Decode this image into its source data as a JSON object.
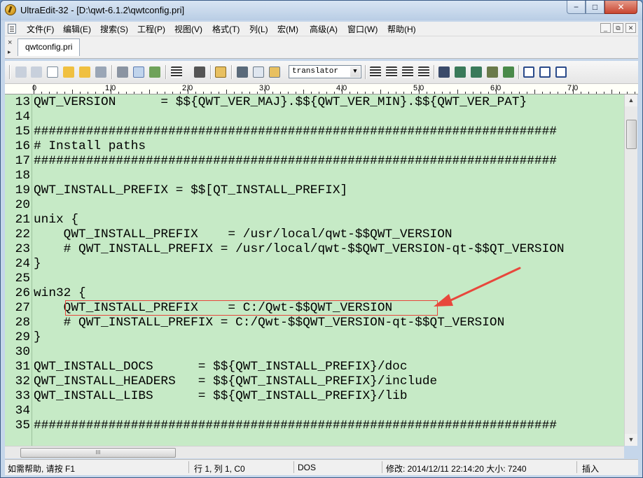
{
  "window": {
    "title": "UltraEdit-32 - [D:\\qwt-6.1.2\\qwtconfig.pri]",
    "controls": {
      "minimize": "−",
      "maximize": "□",
      "close": "✕"
    }
  },
  "menu": {
    "items": [
      "文件(F)",
      "编辑(E)",
      "搜索(S)",
      "工程(P)",
      "视图(V)",
      "格式(T)",
      "列(L)",
      "宏(M)",
      "高级(A)",
      "窗口(W)",
      "帮助(H)"
    ],
    "mdi_controls": [
      "_",
      "⧉",
      "✕"
    ]
  },
  "tabs": {
    "active_file": "qwtconfig.pri",
    "close_glyph": "×",
    "pin_glyph": "▸"
  },
  "toolbar": {
    "combo_value": "translator",
    "combo_arrow": "▼"
  },
  "ruler": {
    "labels": [
      "0",
      "1,0",
      "2,0",
      "3,0",
      "4,0",
      "5,0",
      "6,0",
      "7,0"
    ]
  },
  "editor": {
    "lines": [
      {
        "num": "13",
        "text": "QWT_VERSION      = $${QWT_VER_MAJ}.$${QWT_VER_MIN}.$${QWT_VER_PAT}"
      },
      {
        "num": "14",
        "text": ""
      },
      {
        "num": "15",
        "text": "######################################################################"
      },
      {
        "num": "16",
        "text": "# Install paths"
      },
      {
        "num": "17",
        "text": "######################################################################"
      },
      {
        "num": "18",
        "text": ""
      },
      {
        "num": "19",
        "text": "QWT_INSTALL_PREFIX = $$[QT_INSTALL_PREFIX]"
      },
      {
        "num": "20",
        "text": ""
      },
      {
        "num": "21",
        "text": "unix {"
      },
      {
        "num": "22",
        "text": "    QWT_INSTALL_PREFIX    = /usr/local/qwt-$$QWT_VERSION"
      },
      {
        "num": "23",
        "text": "    # QWT_INSTALL_PREFIX = /usr/local/qwt-$$QWT_VERSION-qt-$$QT_VERSION"
      },
      {
        "num": "24",
        "text": "}"
      },
      {
        "num": "25",
        "text": ""
      },
      {
        "num": "26",
        "text": "win32 {"
      },
      {
        "num": "27",
        "text": "    QWT_INSTALL_PREFIX    = C:/Qwt-$$QWT_VERSION"
      },
      {
        "num": "28",
        "text": "    # QWT_INSTALL_PREFIX = C:/Qwt-$$QWT_VERSION-qt-$$QT_VERSION"
      },
      {
        "num": "29",
        "text": "}"
      },
      {
        "num": "30",
        "text": ""
      },
      {
        "num": "31",
        "text": "QWT_INSTALL_DOCS      = $${QWT_INSTALL_PREFIX}/doc"
      },
      {
        "num": "32",
        "text": "QWT_INSTALL_HEADERS   = $${QWT_INSTALL_PREFIX}/include"
      },
      {
        "num": "33",
        "text": "QWT_INSTALL_LIBS      = $${QWT_INSTALL_PREFIX}/lib"
      },
      {
        "num": "34",
        "text": ""
      },
      {
        "num": "35",
        "text": "######################################################################"
      }
    ],
    "background": "#c6eac6",
    "annotation_color": "#e8473c"
  },
  "scroll": {
    "up": "▲",
    "down": "▼",
    "hthumb_grip": "III"
  },
  "status": {
    "help": "如需帮助, 请按 F1",
    "position": "行 1, 列 1, C0",
    "line_ending": "DOS",
    "modified": "修改: 2014/12/11 22:14:20 大小: 7240",
    "mode": "插入"
  }
}
